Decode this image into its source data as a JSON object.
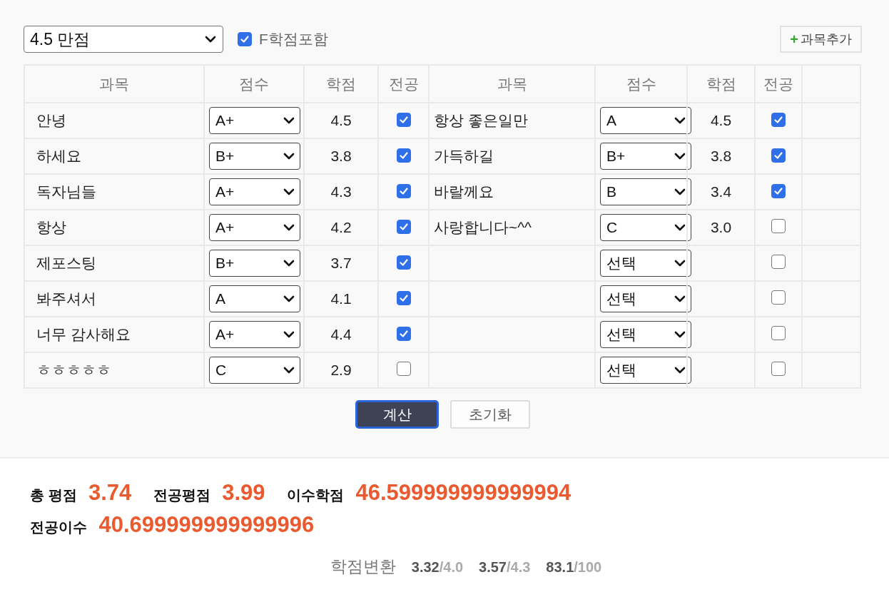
{
  "toolbar": {
    "scale_select": "4.5 만점",
    "include_f": {
      "label": "F학점포함",
      "checked": true
    },
    "add_button": {
      "icon": "+",
      "label": "과목추가"
    }
  },
  "table": {
    "columns": [
      "과목",
      "점수",
      "학점",
      "전공",
      "과목",
      "점수",
      "학점",
      "전공"
    ],
    "rows": [
      {
        "left": {
          "subject": "안녕",
          "grade": "A+",
          "credit": "4.5",
          "major": true
        },
        "right": {
          "subject": "항상 좋은일만",
          "grade": "A",
          "credit": "4.5",
          "major": true
        }
      },
      {
        "left": {
          "subject": "하세요",
          "grade": "B+",
          "credit": "3.8",
          "major": true
        },
        "right": {
          "subject": "가득하길",
          "grade": "B+",
          "credit": "3.8",
          "major": true
        }
      },
      {
        "left": {
          "subject": "독자님들",
          "grade": "A+",
          "credit": "4.3",
          "major": true
        },
        "right": {
          "subject": "바랄께요",
          "grade": "B",
          "credit": "3.4",
          "major": true
        }
      },
      {
        "left": {
          "subject": "항상",
          "grade": "A+",
          "credit": "4.2",
          "major": true
        },
        "right": {
          "subject": "사랑합니다~^^",
          "grade": "C",
          "credit": "3.0",
          "major": false
        }
      },
      {
        "left": {
          "subject": "제포스팅",
          "grade": "B+",
          "credit": "3.7",
          "major": true
        },
        "right": {
          "grade": "선택",
          "major": false
        }
      },
      {
        "left": {
          "subject": "봐주셔서",
          "grade": "A",
          "credit": "4.1",
          "major": true
        },
        "right": {
          "grade": "선택",
          "major": false
        }
      },
      {
        "left": {
          "subject": "너무 감사해요",
          "grade": "A+",
          "credit": "4.4",
          "major": true
        },
        "right": {
          "grade": "선택",
          "major": false
        }
      },
      {
        "left": {
          "subject": "ㅎㅎㅎㅎㅎ",
          "grade": "C",
          "credit": "2.9",
          "major": false
        },
        "right": {
          "grade": "선택",
          "major": false
        }
      }
    ]
  },
  "actions": {
    "calculate": "계산",
    "reset": "초기화"
  },
  "results": {
    "summary": [
      {
        "label": "총 평점",
        "value": "3.74"
      },
      {
        "label": "전공평점",
        "value": "3.99"
      },
      {
        "label": "이수학점",
        "value": "46.599999999999994"
      },
      {
        "label": "전공이수",
        "value": "40.699999999999996"
      }
    ],
    "conversion": {
      "label": "학점변환",
      "items": [
        {
          "value": "3.32",
          "scale": "/4.0"
        },
        {
          "value": "3.57",
          "scale": "/4.3"
        },
        {
          "value": "83.1",
          "scale": "/100"
        }
      ]
    }
  }
}
